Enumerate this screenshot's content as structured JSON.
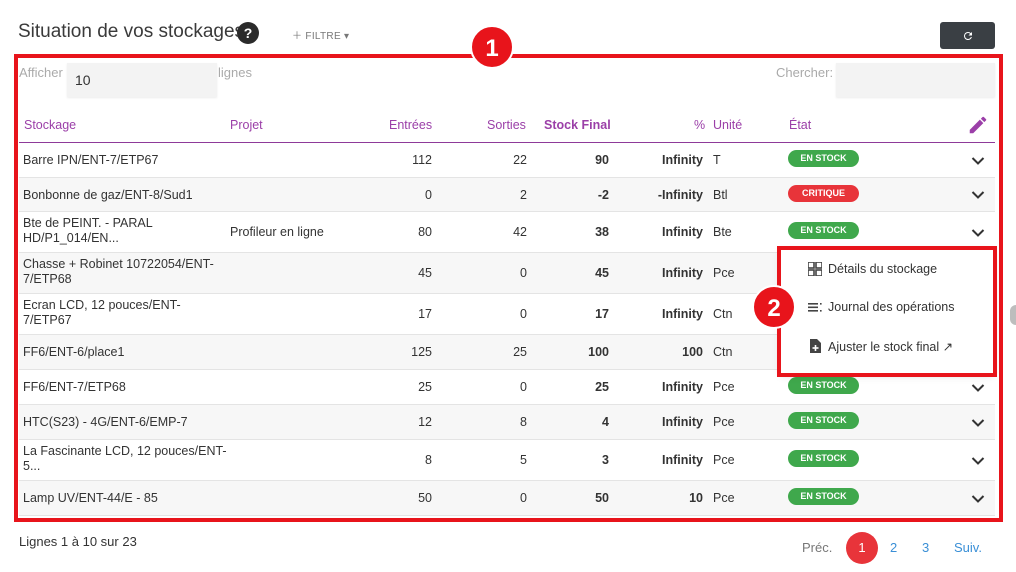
{
  "header": {
    "title": "Situation de vos stockages",
    "help": "?",
    "filter_label": "FILTRE",
    "refresh_icon": "refresh-icon"
  },
  "annotations": [
    "1",
    "2"
  ],
  "controls": {
    "show_label": "Afficher",
    "show_value": "10",
    "lines_label": "lignes",
    "search_label": "Chercher:"
  },
  "table": {
    "columns": {
      "stockage": "Stockage",
      "projet": "Projet",
      "entrees": "Entrées",
      "sorties": "Sorties",
      "stock_final": "Stock Final",
      "pct": "%",
      "unite": "Unité",
      "etat": "État"
    },
    "rows": [
      {
        "stockage": "Barre IPN/ENT-7/ETP67",
        "projet": "",
        "entrees": "112",
        "sorties": "22",
        "stock_final": "90",
        "pct": "Infinity",
        "unite": "T",
        "etat": "EN STOCK",
        "status": "ok"
      },
      {
        "stockage": "Bonbonne de gaz/ENT-8/Sud1",
        "projet": "",
        "entrees": "0",
        "sorties": "2",
        "stock_final": "-2",
        "pct": "-Infinity",
        "unite": "Btl",
        "etat": "CRITIQUE",
        "status": "crit"
      },
      {
        "stockage": "Bte de PEINT. - PARAL HD/P1_014/EN...",
        "projet": "Profileur en ligne",
        "entrees": "80",
        "sorties": "42",
        "stock_final": "38",
        "pct": "Infinity",
        "unite": "Bte",
        "etat": "EN STOCK",
        "status": "ok"
      },
      {
        "stockage": "Chasse + Robinet 10722054/ENT-7/ETP68",
        "projet": "",
        "entrees": "45",
        "sorties": "0",
        "stock_final": "45",
        "pct": "Infinity",
        "unite": "Pce",
        "etat": "",
        "status": "hidden"
      },
      {
        "stockage": "Ecran LCD, 12 pouces/ENT-7/ETP67",
        "projet": "",
        "entrees": "17",
        "sorties": "0",
        "stock_final": "17",
        "pct": "Infinity",
        "unite": "Ctn",
        "etat": "",
        "status": "hidden"
      },
      {
        "stockage": "FF6/ENT-6/place1",
        "projet": "",
        "entrees": "125",
        "sorties": "25",
        "stock_final": "100",
        "pct": "100",
        "unite": "Ctn",
        "etat": "",
        "status": "hidden"
      },
      {
        "stockage": "FF6/ENT-7/ETP68",
        "projet": "",
        "entrees": "25",
        "sorties": "0",
        "stock_final": "25",
        "pct": "Infinity",
        "unite": "Pce",
        "etat": "EN STOCK",
        "status": "ok"
      },
      {
        "stockage": "HTC(S23) - 4G/ENT-6/EMP-7",
        "projet": "",
        "entrees": "12",
        "sorties": "8",
        "stock_final": "4",
        "pct": "Infinity",
        "unite": "Pce",
        "etat": "EN STOCK",
        "status": "ok"
      },
      {
        "stockage": "La Fascinante LCD, 12 pouces/ENT-5...",
        "projet": "",
        "entrees": "8",
        "sorties": "5",
        "stock_final": "3",
        "pct": "Infinity",
        "unite": "Pce",
        "etat": "EN STOCK",
        "status": "ok"
      },
      {
        "stockage": "Lamp UV/ENT-44/E - 85",
        "projet": "",
        "entrees": "50",
        "sorties": "0",
        "stock_final": "50",
        "pct": "10",
        "unite": "Pce",
        "etat": "EN STOCK",
        "status": "ok"
      }
    ]
  },
  "menu": {
    "items": [
      {
        "label": "Détails du stockage",
        "icon": "grid-icon"
      },
      {
        "label": "Journal des opérations",
        "icon": "list-icon"
      },
      {
        "label": "Ajuster le stock final ↗",
        "icon": "file-plus-icon"
      }
    ]
  },
  "footer": {
    "info": "Lignes 1 à 10 sur 23",
    "prev": "Préc.",
    "pages": [
      "1",
      "2",
      "3"
    ],
    "next": "Suiv.",
    "current_page": 1
  },
  "colors": {
    "accent": "#9b3fa8",
    "ok": "#3fa84c",
    "critical": "#e8343a",
    "annotation": "#e8141b"
  }
}
